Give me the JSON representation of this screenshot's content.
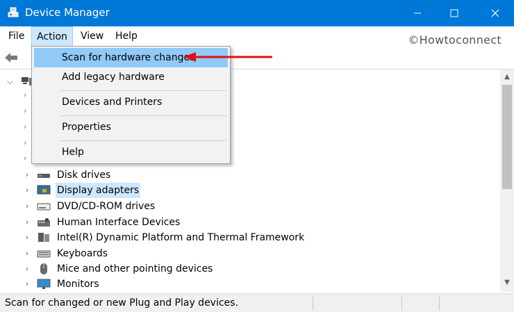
{
  "window": {
    "title": "Device Manager",
    "minimize_glyph": "—",
    "maximize_glyph": "☐",
    "close_glyph": "✕"
  },
  "menubar": {
    "file": "File",
    "action": "Action",
    "view": "View",
    "help": "Help"
  },
  "watermark": "©Howtoconnect",
  "action_menu": {
    "items": [
      {
        "label": "Scan for hardware changes",
        "highlighted": true
      },
      {
        "label": "Add legacy hardware"
      },
      {
        "label": "Devices and Printers"
      },
      {
        "label": "Properties"
      },
      {
        "label": "Help"
      }
    ]
  },
  "tree": {
    "rows": [
      {
        "label": "Disk drives",
        "icon": "disk-drive-icon"
      },
      {
        "label": "Display adapters",
        "icon": "display-adapter-icon",
        "selected": true
      },
      {
        "label": "DVD/CD-ROM drives",
        "icon": "dvd-drive-icon"
      },
      {
        "label": "Human Interface Devices",
        "icon": "hid-icon"
      },
      {
        "label": "Intel(R) Dynamic Platform and Thermal Framework",
        "icon": "intel-framework-icon"
      },
      {
        "label": "Keyboards",
        "icon": "keyboard-icon"
      },
      {
        "label": "Mice and other pointing devices",
        "icon": "mouse-icon"
      },
      {
        "label": "Monitors",
        "icon": "monitor-icon"
      }
    ]
  },
  "statusbar": {
    "text": "Scan for changed or new Plug and Play devices."
  },
  "colors": {
    "titlebar": "#0078d7",
    "highlight": "#91c9f7",
    "selection": "#cce8ff",
    "annotation_arrow": "#e01010"
  }
}
